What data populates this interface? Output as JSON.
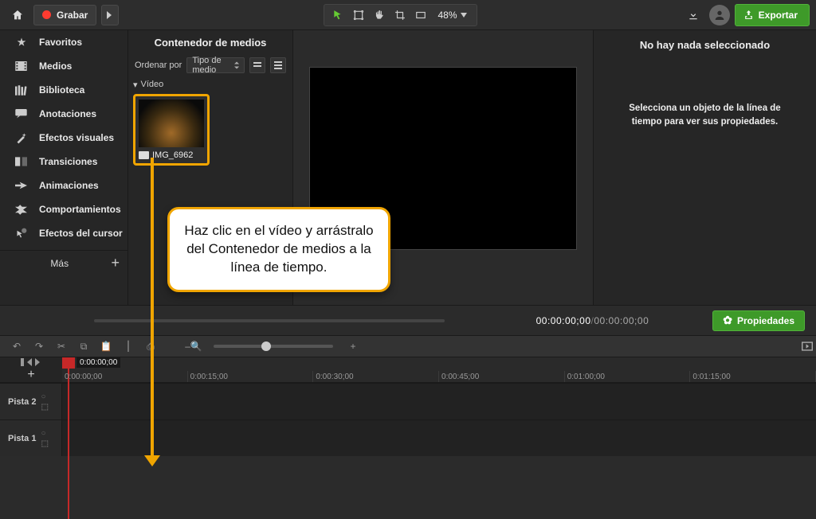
{
  "topbar": {
    "record_label": "Grabar",
    "zoom_label": "48%",
    "export_label": "Exportar"
  },
  "sidebar": {
    "items": [
      {
        "label": "Favoritos"
      },
      {
        "label": "Medios"
      },
      {
        "label": "Biblioteca"
      },
      {
        "label": "Anotaciones"
      },
      {
        "label": "Efectos visuales"
      },
      {
        "label": "Transiciones"
      },
      {
        "label": "Animaciones"
      },
      {
        "label": "Comportamientos"
      },
      {
        "label": "Efectos del cursor"
      }
    ],
    "more_label": "Más"
  },
  "media_bin": {
    "title": "Contenedor de medios",
    "order_label": "Ordenar por",
    "order_value": "Tipo de medio",
    "group_label": "Vídeo",
    "item_name": "IMG_6962"
  },
  "props": {
    "title": "No hay nada seleccionado",
    "message": "Selecciona un objeto de la línea de tiempo para ver sus propiedades.",
    "button_label": "Propiedades"
  },
  "playback": {
    "timecode_current": "00:00:00;00",
    "timecode_total": "00:00:00;00"
  },
  "timeline": {
    "playhead_time": "0:00:00;00",
    "ruler": [
      "0:00:00;00",
      "0:00:15;00",
      "0:00:30;00",
      "0:00:45;00",
      "0:01:00;00",
      "0:01:15;00"
    ],
    "tracks": [
      "Pista 2",
      "Pista 1"
    ]
  },
  "callout": {
    "text": "Haz clic en el vídeo y arrástralo del Contenedor de medios a la línea de tiempo."
  }
}
